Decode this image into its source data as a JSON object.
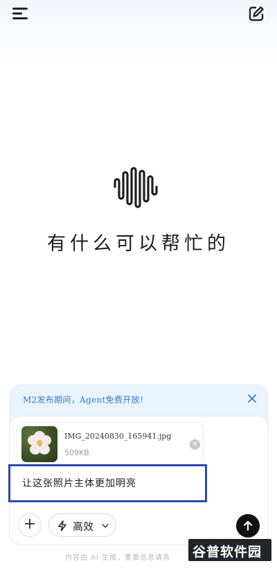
{
  "header": {
    "menu_icon": "hamburger-menu-icon",
    "new_chat_icon": "edit-square-icon"
  },
  "main": {
    "logo_icon": "sound-wave-logo-icon",
    "greeting": "有什么可以帮忙的"
  },
  "composer": {
    "promo_text": "M2发布期间，Agent免费开放！",
    "promo_close_icon": "close-icon",
    "attachment": {
      "file_name": "IMG_20240830_165941.jpg",
      "file_size": "509KB",
      "thumbnail_icon": "flower-photo-thumbnail",
      "remove_icon": "remove-circle-icon"
    },
    "prompt_text": "让这张照片主体更加明亮",
    "add_label": "+",
    "mode_label": "高效",
    "mode_icon": "lightning-icon",
    "chevron_icon": "chevron-down-icon",
    "send_icon": "arrow-up-icon"
  },
  "footer": {
    "disclaimer": "内容由 AI 生成，重要信息请务",
    "watermark": "谷普软件园"
  },
  "colors": {
    "accent_blue": "#2d7fd0",
    "highlight_border": "#2c47b3",
    "composer_bg": "#eaf3fc",
    "send_button": "#111111"
  }
}
